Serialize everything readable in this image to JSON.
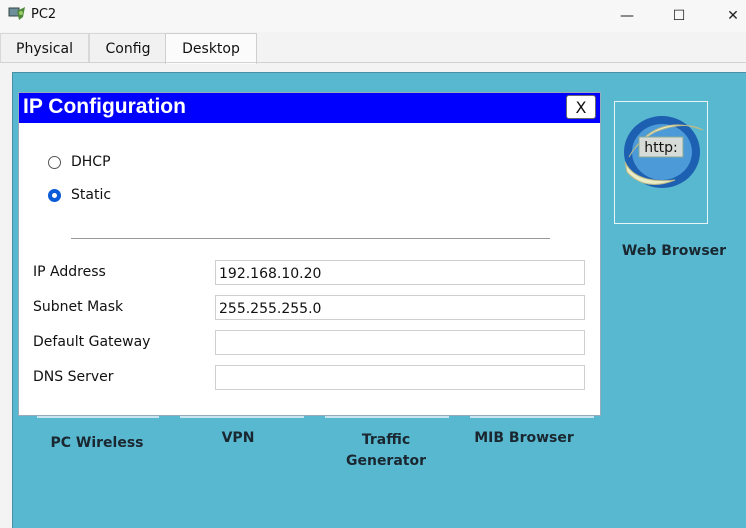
{
  "window": {
    "title": "PC2",
    "icon": "packet-tracer-pc-icon",
    "controls": {
      "minimize": "—",
      "maximize": "☐",
      "close": "✕"
    }
  },
  "tabs": [
    {
      "label": "Physical",
      "active": false
    },
    {
      "label": "Config",
      "active": false
    },
    {
      "label": "Desktop",
      "active": true
    }
  ],
  "dialog": {
    "title": "IP Configuration",
    "close_label": "X",
    "mode_options": [
      {
        "label": "DHCP",
        "selected": false
      },
      {
        "label": "Static",
        "selected": true
      }
    ],
    "fields": [
      {
        "label": "IP Address",
        "value": "192.168.10.20"
      },
      {
        "label": "Subnet Mask",
        "value": "255.255.255.0"
      },
      {
        "label": "Default Gateway",
        "value": ""
      },
      {
        "label": "DNS Server",
        "value": ""
      }
    ]
  },
  "apps": {
    "web_browser": {
      "label": "Web Browser",
      "icon_text": "http:"
    },
    "pc_wireless": "PC Wireless",
    "vpn": "VPN",
    "traffic_generator": "Traffic Generator",
    "mib_browser": "MIB Browser"
  },
  "colors": {
    "desktop_bg": "#58b8d0",
    "dialog_header": "#0000ff",
    "radio_selected": "#0a5bd8"
  }
}
